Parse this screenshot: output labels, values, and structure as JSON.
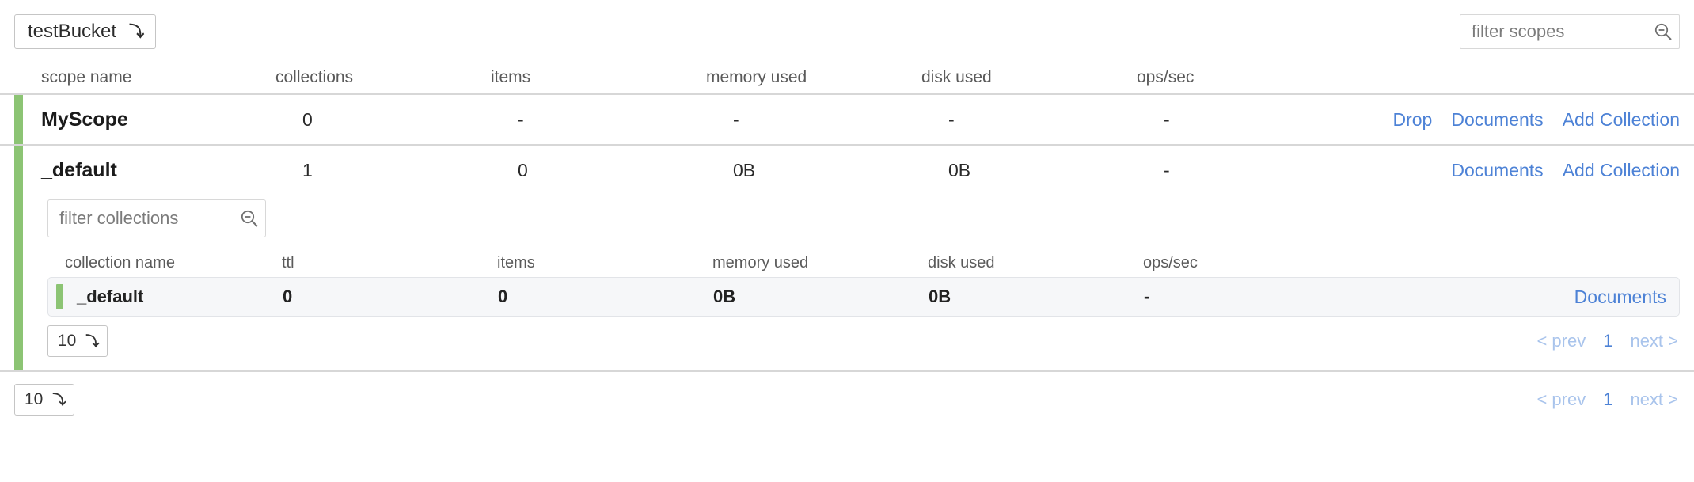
{
  "header": {
    "bucket_label": "testBucket",
    "bucket_chevron_icon": "chevron-down-icon",
    "scope_filter_placeholder": "filter scopes",
    "scope_filter_value": "",
    "scope_filter_icon": "search-icon"
  },
  "colors": {
    "accent_green": "#8cc474",
    "link_blue": "#4d82d6",
    "link_disabled_blue": "#a9c4ec",
    "row_background": "#f6f7f9",
    "separator": "#d7d7d7"
  },
  "scopes_table": {
    "columns": [
      "scope name",
      "collections",
      "items",
      "memory used",
      "disk used",
      "ops/sec"
    ],
    "rows": [
      {
        "name": "MyScope",
        "collections": "0",
        "items": "-",
        "memory_used": "-",
        "disk_used": "-",
        "ops_sec": "-",
        "actions": [
          "Drop",
          "Documents",
          "Add Collection"
        ],
        "expanded": false
      },
      {
        "name": "_default",
        "collections": "1",
        "items": "0",
        "memory_used": "0B",
        "disk_used": "0B",
        "ops_sec": "-",
        "actions": [
          "Documents",
          "Add Collection"
        ],
        "expanded": true
      }
    ]
  },
  "collections_table": {
    "filter_placeholder": "filter collections",
    "filter_value": "",
    "filter_icon": "search-icon",
    "columns": [
      "collection name",
      "ttl",
      "items",
      "memory used",
      "disk used",
      "ops/sec"
    ],
    "rows": [
      {
        "name": "_default",
        "ttl": "0",
        "items": "0",
        "memory_used": "0B",
        "disk_used": "0B",
        "ops_sec": "-",
        "actions": [
          "Documents"
        ]
      }
    ],
    "pager": {
      "page_size": "10",
      "page_size_chevron_icon": "chevron-down-icon",
      "prev_label": "< prev",
      "page_label": "1",
      "next_label": "next >"
    }
  },
  "outer_pager": {
    "page_size": "10",
    "page_size_chevron_icon": "chevron-down-icon",
    "prev_label": "< prev",
    "page_label": "1",
    "next_label": "next >"
  }
}
